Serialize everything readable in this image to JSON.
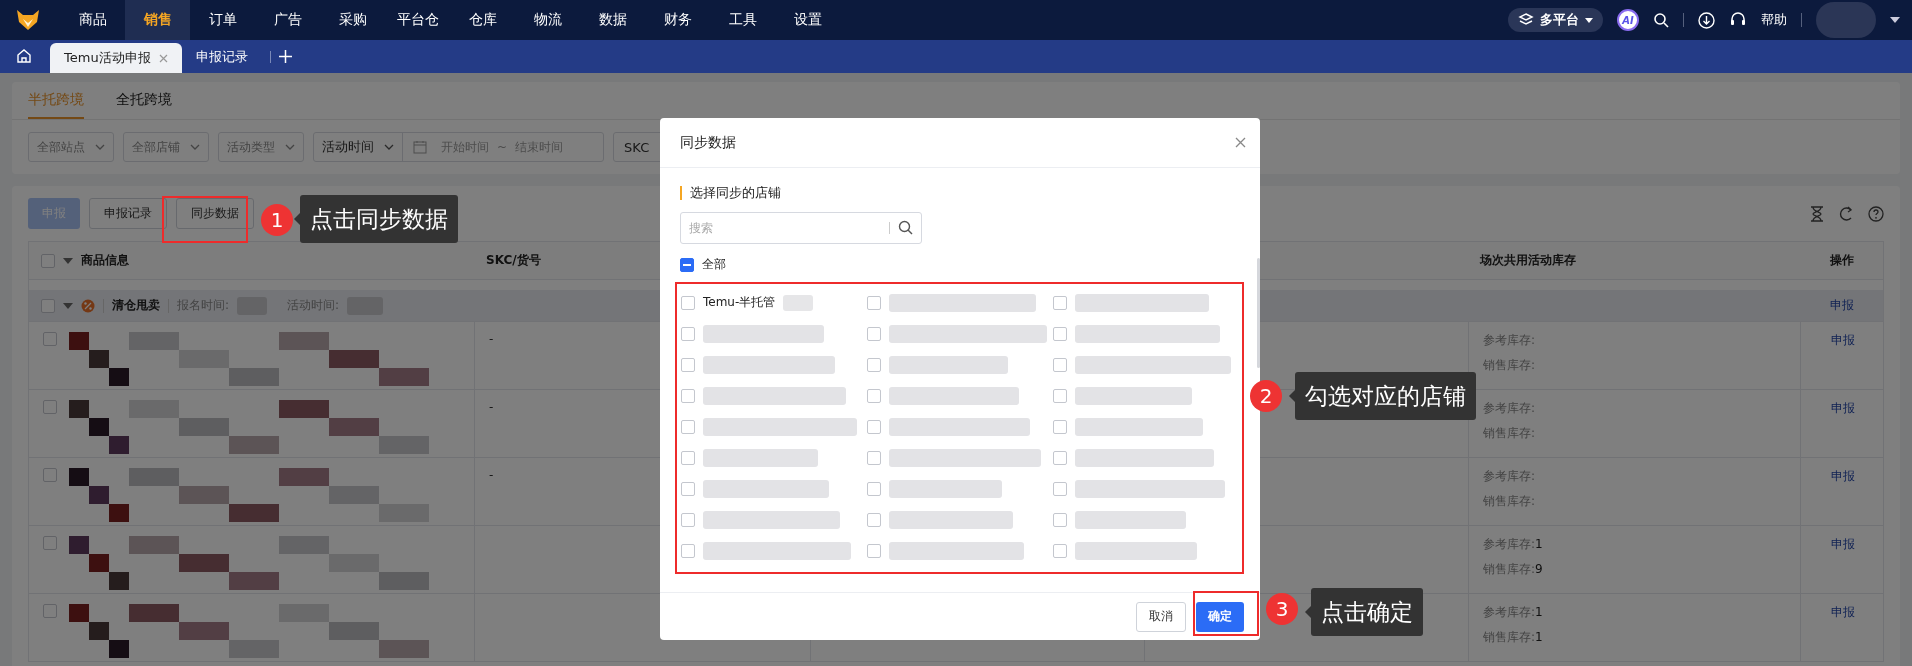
{
  "nav": {
    "items": [
      {
        "label": "商品",
        "selected": false
      },
      {
        "label": "销售",
        "selected": true
      },
      {
        "label": "订单",
        "selected": false
      },
      {
        "label": "广告",
        "selected": false
      },
      {
        "label": "采购",
        "selected": false
      },
      {
        "label": "平台仓",
        "selected": false
      },
      {
        "label": "仓库",
        "selected": false
      },
      {
        "label": "物流",
        "selected": false
      },
      {
        "label": "数据",
        "selected": false
      },
      {
        "label": "财务",
        "selected": false
      },
      {
        "label": "工具",
        "selected": false
      },
      {
        "label": "设置",
        "selected": false
      }
    ],
    "platform": "多平台",
    "ai": "AI",
    "help": "帮助"
  },
  "tabs": [
    {
      "label": "Temu活动申报",
      "selected": true
    },
    {
      "label": "申报记录",
      "selected": false
    }
  ],
  "mode_tabs": [
    {
      "label": "半托跨境",
      "selected": true
    },
    {
      "label": "全托跨境",
      "selected": false
    }
  ],
  "filters": [
    {
      "kind": "select",
      "label": "全部站点"
    },
    {
      "kind": "select",
      "label": "全部店铺"
    },
    {
      "kind": "select",
      "label": "活动类型"
    },
    {
      "kind": "date_range",
      "label": "活动时间",
      "start": "开始时间",
      "separator": "~",
      "end": "结束时间"
    },
    {
      "kind": "input",
      "label": "SKC"
    }
  ],
  "actions": [
    {
      "label": "申报",
      "kind": "primary",
      "disabled": true
    },
    {
      "label": "申报记录",
      "kind": "default"
    },
    {
      "label": "同步数据",
      "kind": "default"
    }
  ],
  "table": {
    "all_checked": false,
    "columns": [
      {
        "label": "商品信息"
      },
      {
        "label": "SKC/货号"
      },
      {},
      {},
      {
        "label": "场次共用活动库存"
      },
      {
        "label": "操作"
      }
    ],
    "group": {
      "checked": false,
      "name": "清仓甩卖",
      "signup_label": "报名时间:",
      "activity_label": "活动时间:",
      "action": "申报"
    },
    "rows": [
      {
        "checked": false,
        "skc": "-",
        "ref_label": "参考库存:",
        "sale_label": "销售库存:",
        "action": "申报"
      },
      {
        "checked": false,
        "skc": "-",
        "ref_label": "参考库存:",
        "sale_label": "销售库存:",
        "action": "申报"
      },
      {
        "checked": false,
        "skc": "-",
        "ref_label": "参考库存:",
        "sale_label": "销售库存:",
        "action": "申报"
      },
      {
        "checked": false,
        "ref_label": "参考库存:",
        "ref_value": "1",
        "sale_label": "销售库存:",
        "sale_value": "9",
        "action": "申报"
      },
      {
        "checked": false,
        "ref_label": "参考库存:",
        "ref_value": "1",
        "sale_label": "销售库存:",
        "sale_value": "1",
        "action": "申报"
      }
    ]
  },
  "dialog": {
    "title": "同步数据",
    "section": "选择同步的店铺",
    "search_placeholder": "搜索",
    "select_all": {
      "label": "全部",
      "indeterminate": true
    },
    "stores": [
      {
        "kind": "named",
        "label": "Temu-半托管",
        "checked": false
      },
      {
        "kind": "redacted",
        "checked": false
      },
      {
        "kind": "redacted",
        "checked": false
      },
      {
        "kind": "redacted",
        "checked": false
      },
      {
        "kind": "redacted",
        "checked": false
      },
      {
        "kind": "redacted",
        "checked": false
      },
      {
        "kind": "redacted",
        "checked": false
      },
      {
        "kind": "redacted",
        "checked": false
      },
      {
        "kind": "redacted",
        "checked": false
      },
      {
        "kind": "redacted",
        "checked": false
      },
      {
        "kind": "redacted",
        "checked": false
      },
      {
        "kind": "redacted",
        "checked": false
      },
      {
        "kind": "redacted",
        "checked": false
      },
      {
        "kind": "redacted",
        "checked": false
      },
      {
        "kind": "redacted",
        "checked": false
      },
      {
        "kind": "redacted",
        "checked": false
      },
      {
        "kind": "redacted",
        "checked": false
      },
      {
        "kind": "redacted",
        "checked": false
      },
      {
        "kind": "redacted",
        "checked": false
      },
      {
        "kind": "redacted",
        "checked": false
      },
      {
        "kind": "redacted",
        "checked": false
      },
      {
        "kind": "redacted",
        "checked": false
      },
      {
        "kind": "redacted",
        "checked": false
      },
      {
        "kind": "redacted",
        "checked": false
      },
      {
        "kind": "redacted",
        "checked": false
      },
      {
        "kind": "redacted",
        "checked": false
      },
      {
        "kind": "redacted",
        "checked": false
      }
    ],
    "cancel": "取消",
    "confirm": "确定"
  },
  "annotations": [
    {
      "number": "1",
      "text": "点击同步数据"
    },
    {
      "number": "2",
      "text": "勾选对应的店铺"
    },
    {
      "number": "3",
      "text": "点击确定"
    }
  ]
}
